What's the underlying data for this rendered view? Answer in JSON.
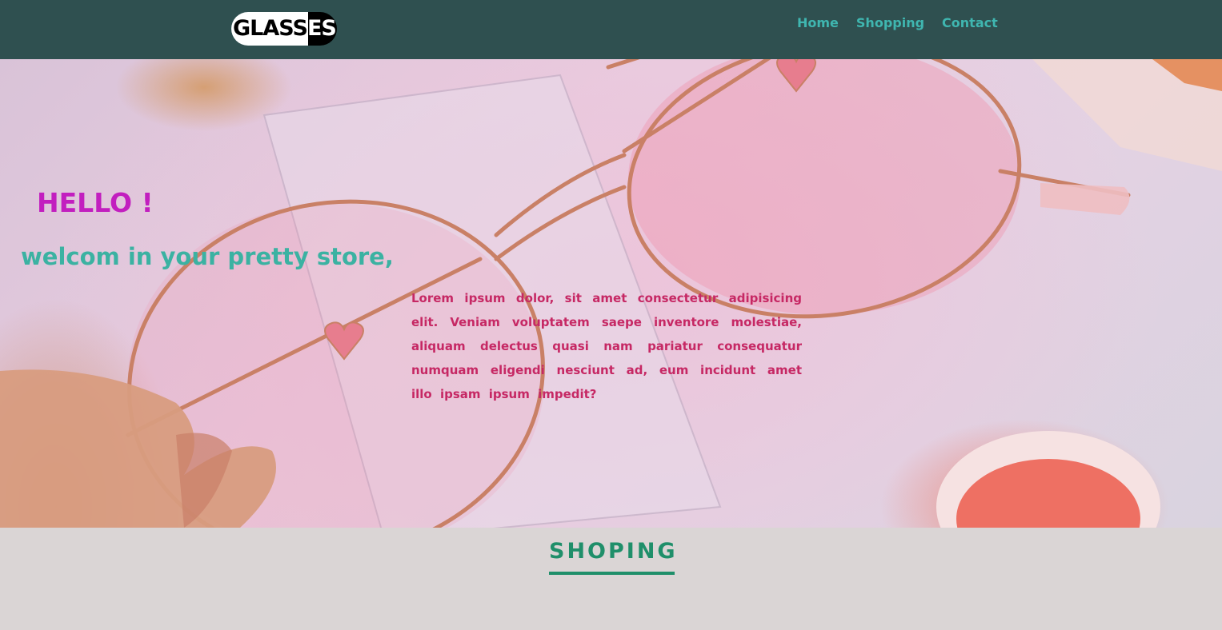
{
  "header": {
    "logo": {
      "dark_part": "GLASS",
      "light_part": "ES"
    },
    "nav": [
      {
        "label": "Home"
      },
      {
        "label": "Shopping"
      },
      {
        "label": "Contact"
      }
    ]
  },
  "hero": {
    "greeting": "HELLO !",
    "subtitle": "welcom in your pretty store,",
    "body": "Lorem ipsum dolor, sit amet consectetur adipisicing elit. Veniam voluptatem saepe inventore molestiae, aliquam delectus quasi nam pariatur consequatur numquam eligendi nesciunt ad, eum incidunt amet illo ipsam ipsum impedit?"
  },
  "shopping_section": {
    "title": "SHOPING"
  },
  "colors": {
    "navbar_bg": "#2f5050",
    "nav_link": "#3fb6b0",
    "greeting": "#c21fbf",
    "subtitle": "#3bb2a2",
    "body_text": "#c62864",
    "section_title": "#1f8f6a",
    "section_bg": "#dad5d5"
  },
  "icons": {
    "hero_image": "pink-glasses-photo"
  }
}
